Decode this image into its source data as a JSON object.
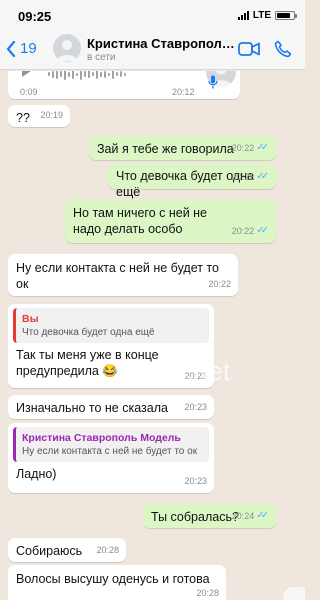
{
  "status_bar": {
    "time": "09:25",
    "network": "LTE"
  },
  "header": {
    "back_count": "19",
    "contact_name": "Кристина Ставрополь Модель",
    "contact_status": "в сети"
  },
  "voice_message": {
    "duration": "0:09",
    "time": "20:12"
  },
  "messages": [
    {
      "dir": "in",
      "text": "??",
      "time": "20:19"
    },
    {
      "dir": "out",
      "text": "Зай я тебе же говорила",
      "time": "20:22"
    },
    {
      "dir": "out",
      "text": "Что девочка будет одна ещё",
      "time": "20:22"
    },
    {
      "dir": "out",
      "text": "Но там ничего с ней не надо делать особо",
      "time": "20:22"
    },
    {
      "dir": "in",
      "text": "Ну если контакта с ней не будет то ок",
      "time": "20:22"
    },
    {
      "dir": "in",
      "quote_author": "Вы",
      "quote_text": "Что девочка будет одна ещё",
      "text": "Так ты меня уже в конце предупредила 😂",
      "time": "20:23"
    },
    {
      "dir": "in",
      "text": "Изначально то не сказала",
      "time": "20:23"
    },
    {
      "dir": "in",
      "quote_author": "Кристина Ставрополь Модель",
      "quote_text": "Ну если контакта с ней не будет то ок",
      "text": "Ладно)",
      "time": "20:23"
    },
    {
      "dir": "out",
      "text": "Ты собралась?",
      "time": "20:24"
    },
    {
      "dir": "in",
      "text": "Собираюсь",
      "time": "20:28"
    },
    {
      "dir": "in",
      "text": "Волосы высушу оденусь и готова",
      "time": "20:28"
    }
  ],
  "watermark": "ut.net",
  "colors": {
    "accent": "#1a7cf2",
    "outgoing_bubble": "#dcf7c5",
    "incoming_bubble": "#ffffff",
    "read_ticks": "#4fb6ec"
  }
}
